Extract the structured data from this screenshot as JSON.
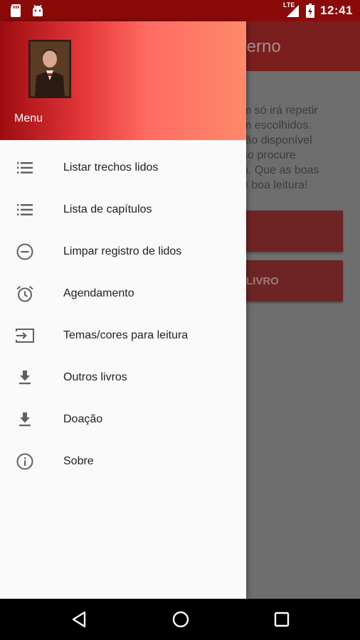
{
  "status_bar": {
    "time": "12:41",
    "network": "LTE",
    "icons": [
      "sd-card-icon",
      "android-icon",
      "signal-icon",
      "battery-icon"
    ]
  },
  "background_app": {
    "title_fragment": "ferno",
    "text_lines": [
      "m só irá repetir",
      "m escolhidos.",
      "tão disponível",
      "so procure",
      "u. Que as boas",
      "e boa leitura!"
    ],
    "button2_fragment": "LIVRO"
  },
  "drawer": {
    "header_label": "Menu",
    "items": [
      {
        "label": "Listar trechos lidos",
        "icon": "list-icon"
      },
      {
        "label": "Lista de capítulos",
        "icon": "list-icon"
      },
      {
        "label": "Limpar registro de lidos",
        "icon": "remove-circle-icon"
      },
      {
        "label": "Agendamento",
        "icon": "alarm-icon"
      },
      {
        "label": "Temas/cores para leitura",
        "icon": "input-icon"
      },
      {
        "label": "Outros livros",
        "icon": "download-icon"
      },
      {
        "label": "Doação",
        "icon": "download-icon"
      },
      {
        "label": "Sobre",
        "icon": "info-icon"
      }
    ]
  },
  "nav_bar": {
    "buttons": [
      "back-icon",
      "home-icon",
      "recents-icon"
    ]
  },
  "colors": {
    "status_bar": "#8a0a0a",
    "header_gradient_start": "#9e0c10",
    "header_gradient_end": "#ff8a6a",
    "drawer_bg": "#fafafa"
  }
}
